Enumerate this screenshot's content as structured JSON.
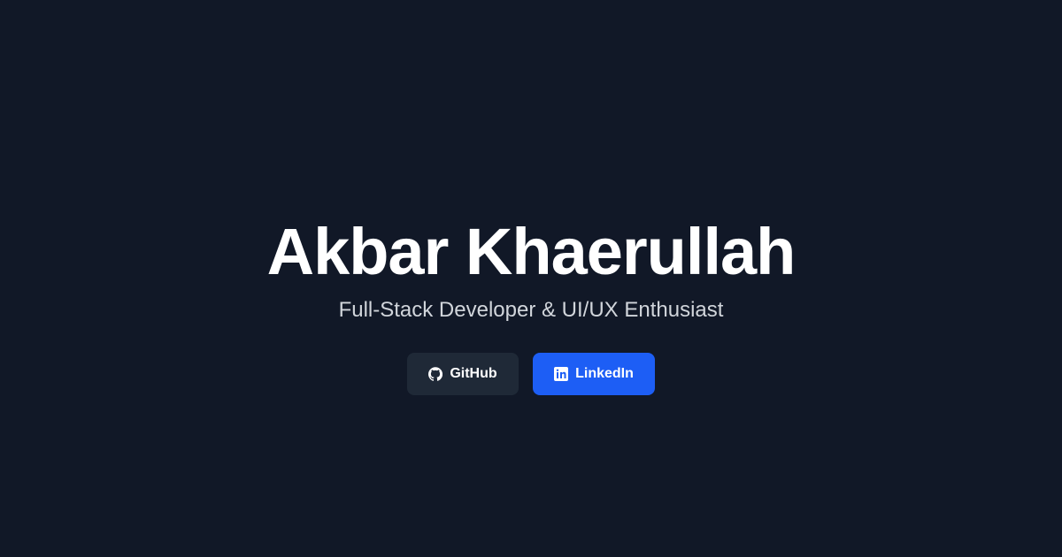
{
  "profile": {
    "name": "Akbar Khaerullah",
    "tagline": "Full-Stack Developer & UI/UX Enthusiast"
  },
  "links": {
    "github": {
      "label": "GitHub",
      "icon": "github-icon"
    },
    "linkedin": {
      "label": "LinkedIn",
      "icon": "linkedin-icon"
    }
  },
  "colors": {
    "background": "#111827",
    "title": "#ffffff",
    "subtitle": "#d1d5db",
    "github_button": "#1f2937",
    "linkedin_button": "#1d5ef5"
  }
}
